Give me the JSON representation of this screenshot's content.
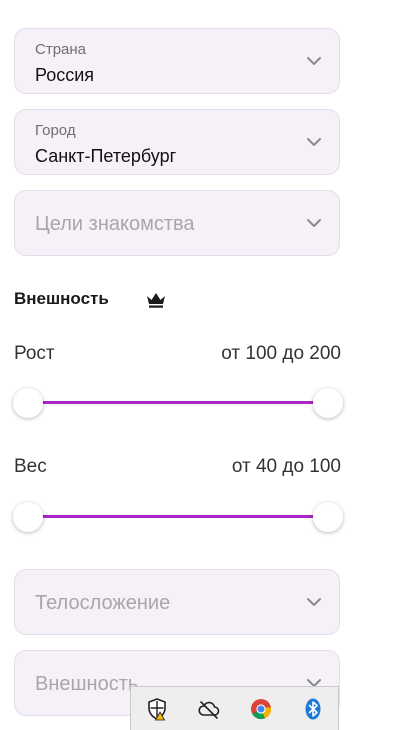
{
  "country": {
    "label": "Страна",
    "value": "Россия"
  },
  "city": {
    "label": "Город",
    "value": "Санкт-Петербург"
  },
  "goals": {
    "placeholder": "Цели знакомства"
  },
  "appearance_section": {
    "title": "Внешность"
  },
  "height": {
    "label": "Рост",
    "range_text": "от 100 до 200",
    "min": 100,
    "max": 200
  },
  "weight": {
    "label": "Вес",
    "range_text": "от 40 до 100",
    "min": 40,
    "max": 100
  },
  "body_type": {
    "placeholder": "Телосложение"
  },
  "appearance": {
    "placeholder": "Внешность"
  },
  "colors": {
    "accent": "#a827c7",
    "field_bg": "#f6f0f8"
  },
  "tray": {
    "icons": [
      "shield-warning-icon",
      "cloud-offline-icon",
      "chrome-icon",
      "bluetooth-icon"
    ]
  }
}
